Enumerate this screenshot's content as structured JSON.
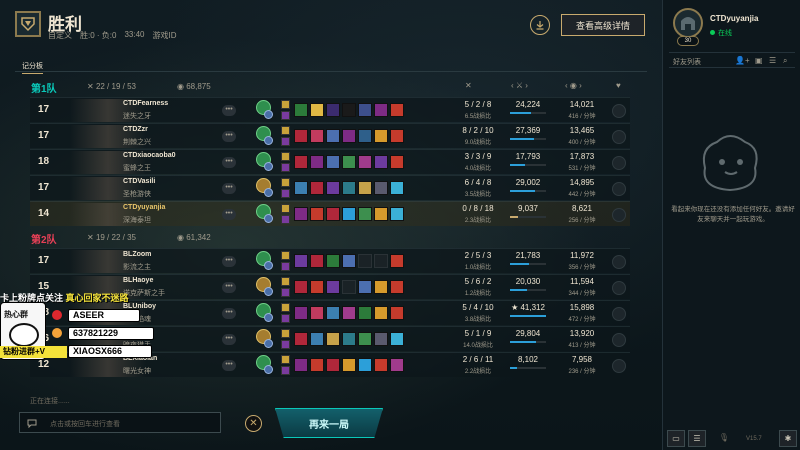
{
  "header": {
    "title": "胜利",
    "mode": "自定义",
    "record": "胜:0 · 负:0",
    "duration": "33:40",
    "game_id_label": "游戏ID",
    "detail_button": "查看高级详情"
  },
  "tabs": {
    "scoreboard": "记分板"
  },
  "team1": {
    "name": "第1队",
    "kda": "22 / 19 / 53",
    "gold": "68,875"
  },
  "team2": {
    "name": "第2队",
    "kda": "19 / 22 / 35",
    "gold": "61,342"
  },
  "players": [
    {
      "level": "17",
      "name": "CTDFearness",
      "champion": "迷失之牙",
      "kda": "5 / 2 / 8",
      "ratio": "6.5战损比",
      "damage": "24,224",
      "damage_frac": 0.59,
      "gold": "14,021",
      "gpm": "416 / 分钟",
      "rune": "green",
      "me": false,
      "items": [
        "#2c7b3a",
        "#e0b844",
        "#3b2b6e",
        "#1a1a1a",
        "#3d4f8c",
        "#7e2b85",
        "#c63b2c"
      ]
    },
    {
      "level": "17",
      "name": "CTDZzr",
      "champion": "荆棘之兴",
      "kda": "8 / 2 / 10",
      "ratio": "9.0战损比",
      "damage": "27,369",
      "damage_frac": 0.66,
      "gold": "13,465",
      "gpm": "400 / 分钟",
      "rune": "green",
      "me": false,
      "items": [
        "#b0273a",
        "#c23b5e",
        "#4c6fb0",
        "#7e2b85",
        "#2e5f8a",
        "#d69a2c",
        "#c63b2c"
      ]
    },
    {
      "level": "18",
      "name": "CTDxiaocaoba0",
      "champion": "蜜蜂之王",
      "kda": "3 / 3 / 9",
      "ratio": "4.0战损比",
      "damage": "17,793",
      "damage_frac": 0.43,
      "gold": "17,873",
      "gpm": "531 / 分钟",
      "rune": "green",
      "me": false,
      "items": [
        "#b0273a",
        "#7e2b85",
        "#4c6fb0",
        "#3d8f4e",
        "#a03b8c",
        "#6c3b9e",
        "#c63b2c"
      ]
    },
    {
      "level": "17",
      "name": "CTDVasili",
      "champion": "圣枪游侠",
      "kda": "6 / 4 / 8",
      "ratio": "3.5战损比",
      "damage": "29,002",
      "damage_frac": 0.7,
      "gold": "14,895",
      "gpm": "442 / 分钟",
      "rune": "precision",
      "me": false,
      "items": [
        "#3c7fb0",
        "#b0273a",
        "#6c3b9e",
        "#2c7b8a",
        "#c6a24a",
        "#5a5a6e",
        "#3bb0d6"
      ]
    },
    {
      "level": "14",
      "name": "CTDyuyanjia",
      "champion": "深海泰坦",
      "kda": "0 / 8 / 18",
      "ratio": "2.3战损比",
      "damage": "9,037",
      "damage_frac": 0.22,
      "gold": "8,621",
      "gpm": "256 / 分钟",
      "rune": "green",
      "me": true,
      "items": [
        "#7e2b85",
        "#c63b2c",
        "#b0273a",
        "#2c9fd9",
        "#3d8f4e",
        "#d69a2c",
        "#3bb0d6"
      ]
    },
    {
      "level": "17",
      "name": "BLZoom",
      "champion": "影流之主",
      "kda": "2 / 5 / 3",
      "ratio": "1.0战损比",
      "damage": "21,783",
      "damage_frac": 0.53,
      "gold": "11,972",
      "gpm": "356 / 分钟",
      "rune": "green",
      "me": false,
      "items": [
        "#6c3b9e",
        "#b0273a",
        "#2c7b3a",
        "#4c6fb0",
        "empty",
        "empty",
        "#c63b2c"
      ]
    },
    {
      "level": "15",
      "name": "BLHaoye",
      "champion": "诺克萨斯之手",
      "kda": "5 / 6 / 2",
      "ratio": "1.2战损比",
      "damage": "20,030",
      "damage_frac": 0.48,
      "gold": "11,594",
      "gpm": "344 / 分钟",
      "rune": "precision",
      "me": false,
      "items": [
        "#b0273a",
        "#c63b2c",
        "#6c3b9e",
        "empty",
        "#4c6fb0",
        "#d69a2c",
        "#c63b2c"
      ]
    },
    {
      "level": "18",
      "name": "BLUniboy",
      "champion": "复仇焰魂",
      "kda": "5 / 4 / 10",
      "ratio": "3.8战损比",
      "damage": "★ 41,312",
      "damage_frac": 1.0,
      "gold": "15,898",
      "gpm": "472 / 分钟",
      "rune": "green",
      "me": false,
      "items": [
        "#7e2b85",
        "#c23b5e",
        "#3c7fb0",
        "#a03b8c",
        "#2c7b3a",
        "#d69a2c",
        "#c63b2c"
      ]
    },
    {
      "level": "16",
      "name": "BLZcang",
      "champion": "暗夜猎手",
      "kda": "5 / 1 / 9",
      "ratio": "14.0战损比",
      "damage": "29,804",
      "damage_frac": 0.72,
      "gold": "13,920",
      "gpm": "413 / 分钟",
      "rune": "precision",
      "me": false,
      "items": [
        "#b0273a",
        "#3c7fb0",
        "#c6a24a",
        "#2c7b8a",
        "#3d8f4e",
        "#5a5a6e",
        "#3bb0d6"
      ]
    },
    {
      "level": "12",
      "name": "BLXiaolan",
      "champion": "曙光女神",
      "kda": "2 / 6 / 11",
      "ratio": "2.2战损比",
      "damage": "8,102",
      "damage_frac": 0.2,
      "gold": "7,958",
      "gpm": "236 / 分钟",
      "rune": "green",
      "me": false,
      "items": [
        "#7e2b85",
        "#c63b2c",
        "#b0273a",
        "#d69a2c",
        "#2c9fd9",
        "#c63b2c",
        "#a03b8c"
      ]
    }
  ],
  "bottom": {
    "connecting": "正在连接......",
    "chat_placeholder": "点击或按回车进行查看",
    "play_again": "再来一局"
  },
  "overlay": {
    "line1a": "卡上粉牌点关注",
    "line1b": "真心回家不迷路",
    "logo_text": "热心群",
    "tag1": "ASEER",
    "tag2": "637821229",
    "tag3": "XIAOSX666",
    "bottom_label": "钻粉进群+V"
  },
  "sidebar": {
    "username": "CTDyuyanjia",
    "status": "在线",
    "level": "30",
    "friends_label": "好友列表",
    "empty_message": "看起来你现在还没有添加任何好友。邀请好友来聊天并一起玩游戏。",
    "version": "V15.7"
  },
  "colors": {
    "blue_team": "#0ac8b9",
    "red_team": "#e84057",
    "gold": "#c8aa6e"
  }
}
